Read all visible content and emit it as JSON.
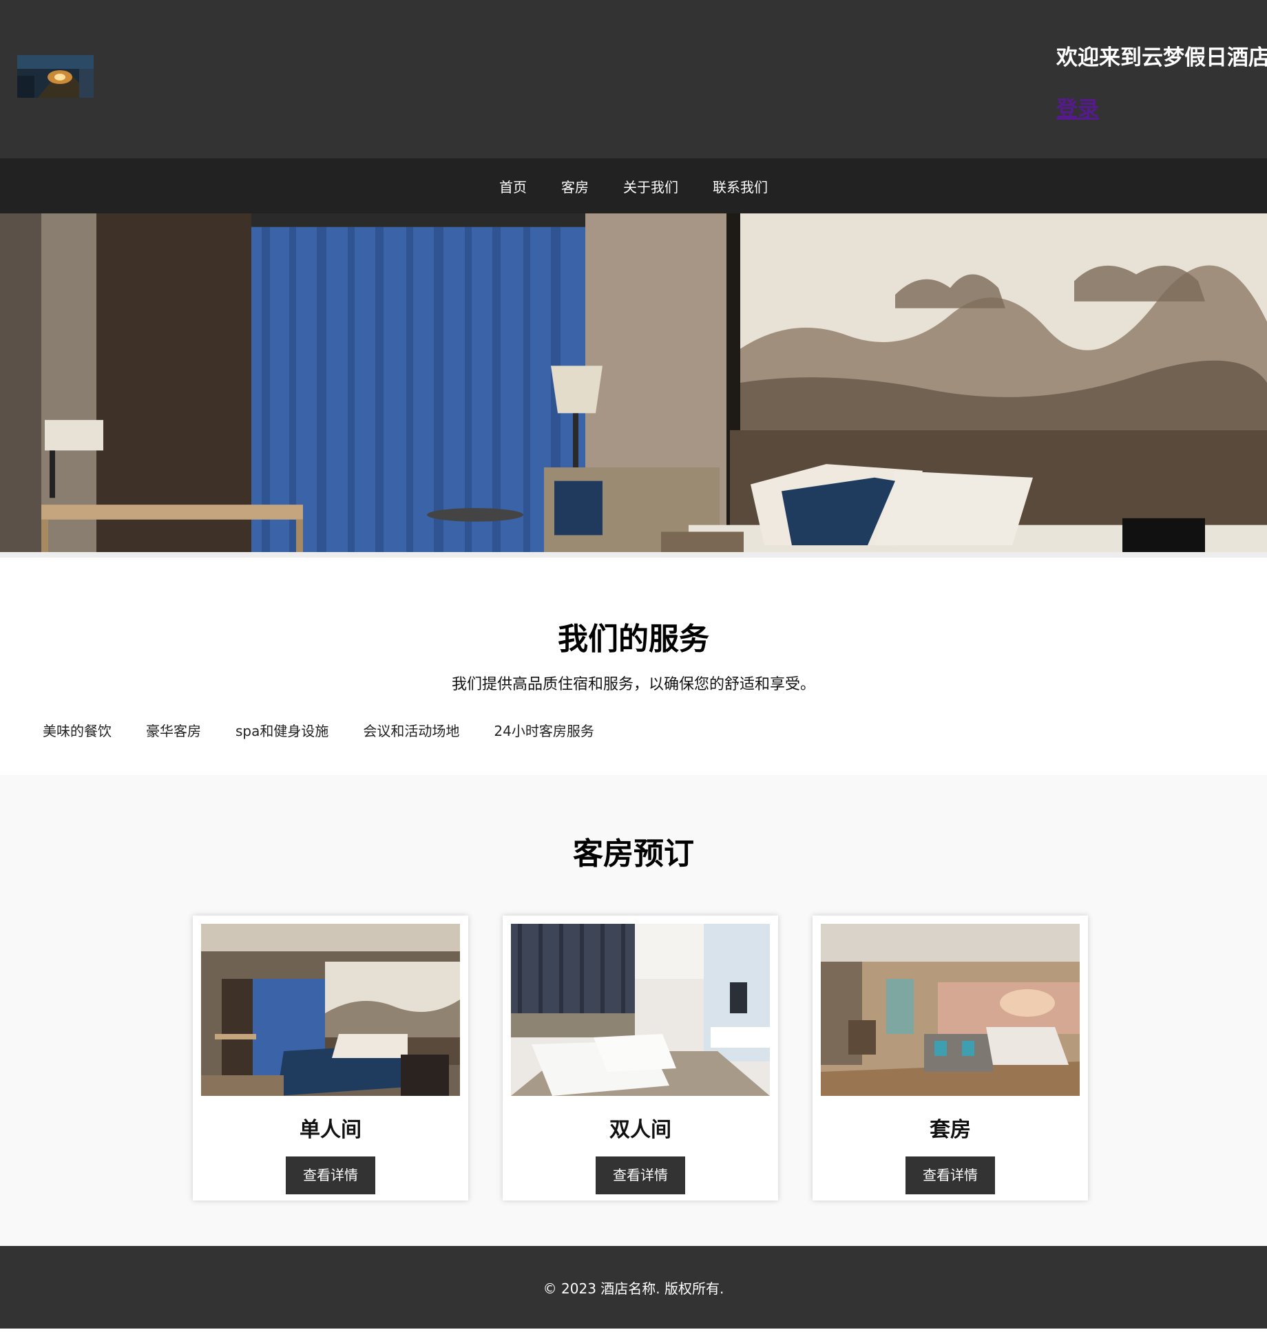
{
  "header": {
    "welcome": "欢迎来到云梦假日酒店",
    "login": "登录"
  },
  "nav": {
    "items": [
      "首页",
      "客房",
      "关于我们",
      "联系我们"
    ]
  },
  "services": {
    "title": "我们的服务",
    "description": "我们提供高品质住宿和服务，以确保您的舒适和享受。",
    "items": [
      "美味的餐饮",
      "豪华客房",
      "spa和健身设施",
      "会议和活动场地",
      "24小时客房服务"
    ]
  },
  "rooms": {
    "title": "客房预订",
    "cards": [
      {
        "name": "单人间",
        "button": "查看详情"
      },
      {
        "name": "双人间",
        "button": "查看详情"
      },
      {
        "name": "套房",
        "button": "查看详情"
      }
    ]
  },
  "footer": {
    "copyright": "© 2023 酒店名称. 版权所有."
  },
  "colors": {
    "header_bg": "#333333",
    "nav_bg": "#222222",
    "button_bg": "#333333",
    "link_visited": "#551a8b"
  }
}
